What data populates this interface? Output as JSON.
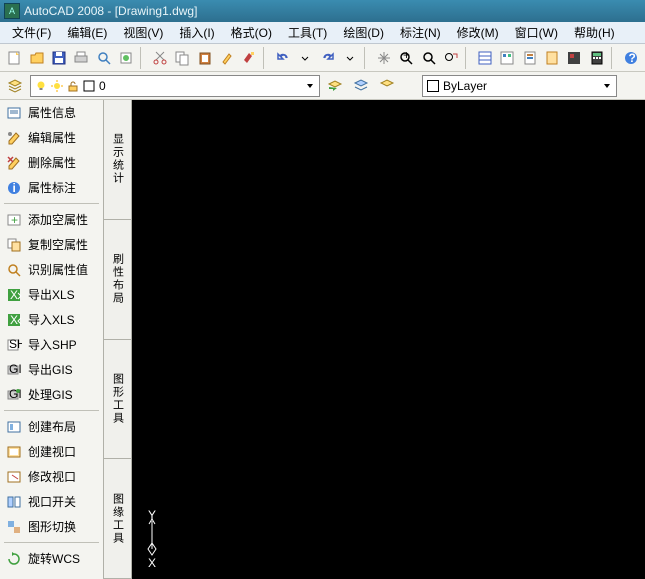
{
  "title": "AutoCAD 2008 - [Drawing1.dwg]",
  "menu": {
    "file": "文件(F)",
    "edit": "编辑(E)",
    "view": "视图(V)",
    "insert": "插入(I)",
    "format": "格式(O)",
    "tools": "工具(T)",
    "draw": "绘图(D)",
    "dimension": "标注(N)",
    "modify": "修改(M)",
    "window": "窗口(W)",
    "help": "帮助(H)"
  },
  "layer": {
    "current": "0"
  },
  "bylayer": {
    "label": "ByLayer"
  },
  "sidebar": {
    "g1": [
      {
        "k": "attr-info",
        "label": "属性信息"
      },
      {
        "k": "edit-attr",
        "label": "编辑属性"
      },
      {
        "k": "delete-attr",
        "label": "删除属性"
      },
      {
        "k": "attr-annotate",
        "label": "属性标注"
      }
    ],
    "g2": [
      {
        "k": "add-spatial-attr",
        "label": "添加空属性"
      },
      {
        "k": "copy-spatial-attr",
        "label": "复制空属性"
      },
      {
        "k": "identify-attr",
        "label": "识别属性值"
      },
      {
        "k": "export-xls",
        "label": "导出XLS"
      },
      {
        "k": "import-xls",
        "label": "导入XLS"
      },
      {
        "k": "import-shp",
        "label": "导入SHP"
      },
      {
        "k": "export-gis",
        "label": "导出GIS"
      },
      {
        "k": "process-gis",
        "label": "处理GIS"
      }
    ],
    "g3": [
      {
        "k": "create-layout",
        "label": "创建布局"
      },
      {
        "k": "create-viewport",
        "label": "创建视口"
      },
      {
        "k": "modify-viewport",
        "label": "修改视口"
      },
      {
        "k": "viewport-switch",
        "label": "视口开关"
      },
      {
        "k": "toggle-shape",
        "label": "图形切换"
      }
    ],
    "g4": [
      {
        "k": "rotate-wcs",
        "label": "旋转WCS"
      }
    ]
  },
  "tabs": {
    "t1": "显示统计",
    "t2": "刷性布局",
    "t3": "图形工具",
    "t4": "图缘工具"
  },
  "axis": {
    "y": "Y",
    "x": "X"
  }
}
